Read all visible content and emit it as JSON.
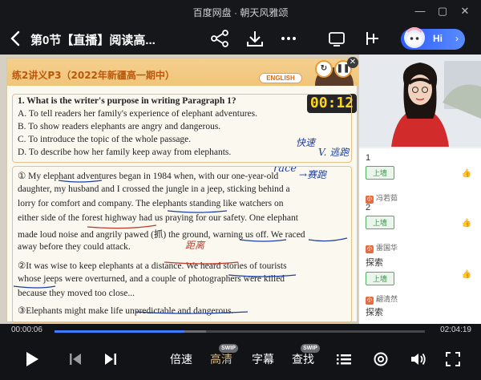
{
  "window": {
    "app_title": "百度网盘 · 朝天风雅颂"
  },
  "header": {
    "lesson_title": "第0节【直播】阅读高...",
    "hi_label": "Hi",
    "hi_arrow": "›"
  },
  "slide": {
    "title": "练2讲义P3（2022年新疆高一期中）",
    "badge": "ENGLISH",
    "timer": "00:12",
    "question": {
      "stem": "1. What is the writer's purpose in writing Paragraph 1?",
      "options": [
        "A. To tell readers her family's experience of elephant adventures.",
        "B. To show readers elephants are angry and dangerous.",
        "C. To introduce the topic of the whole passage.",
        "D. To describe how her family keep away from elephants."
      ]
    },
    "passage": [
      "① My elephant adventures began in 1984 when, with our one-year-old",
      "daughter, my husband and I crossed the jungle in a jeep, sticking behind a",
      "lorry for comfort and company. The elephants standing like watchers on",
      "either side of the forest highway had us praying for our safety. One elephant",
      "made loud noise and angrily pawed (抓) the ground, warning us off. We raced",
      "away before they could attack.",
      "②It was wise to keep elephants at a distance. We heard stories of tourists",
      "whose jeeps were overturned, and a couple of photographers were killed",
      "because they moved too close...",
      "③Elephants might make life unpredictable and dangerous."
    ],
    "annotations": {
      "a1": "快速",
      "a2": "V. 逃跑",
      "a3": "race",
      "a4": "→赛跑",
      "a5": "距离"
    }
  },
  "chat": {
    "items": [
      {
        "num": "1",
        "pill": "上墙"
      },
      {
        "badge": "小",
        "user": "冯若茹"
      },
      {
        "num": "2",
        "pill": "上墙"
      },
      {
        "badge": "小",
        "user": "雷国华"
      },
      {
        "text": "探索",
        "pill": "上墙"
      },
      {
        "badge": "小",
        "user": "翩清然"
      },
      {
        "text": "探索"
      }
    ]
  },
  "player": {
    "current_time": "00:00:06",
    "total_time": "02:04:19",
    "progress_fraction": 0.35,
    "buffered_fraction": 0.41,
    "speed_label": "倍速",
    "quality_label": "高清",
    "subtitle_label": "字幕",
    "search_label": "查找",
    "swip_badge": "SWIP"
  },
  "colors": {
    "accent": "#3d7bff",
    "quality_active": "#d4b88a",
    "timer_digits": "#ffd51e",
    "handwriting": "#1d3fa6",
    "handwriting_red": "#c0392b"
  }
}
